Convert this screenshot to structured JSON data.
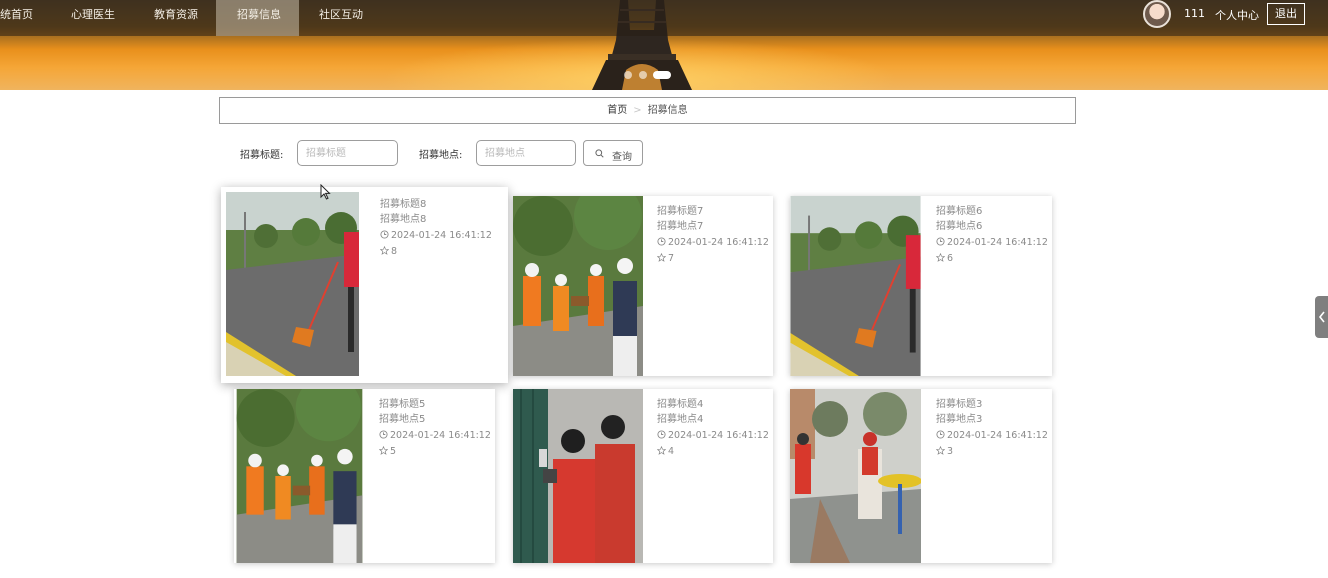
{
  "nav": {
    "items": [
      {
        "label": "统首页"
      },
      {
        "label": "心理医生"
      },
      {
        "label": "教育资源"
      },
      {
        "label": "招募信息"
      },
      {
        "label": "社区互动"
      }
    ],
    "user_id": "111",
    "personal_center": "个人中心",
    "logout": "退出"
  },
  "breadcrumb": {
    "home": "首页",
    "separator": ">",
    "current": "招募信息"
  },
  "search": {
    "title_label": "招募标题:",
    "title_placeholder": "招募标题",
    "location_label": "招募地点:",
    "location_placeholder": "招募地点",
    "button_label": "查询"
  },
  "cards": [
    {
      "title": "招募标题8",
      "location": "招募地点8",
      "time": "2024-01-24 16:41:12",
      "favorites": "8",
      "scene": "sweeping"
    },
    {
      "title": "招募标题7",
      "location": "招募地点7",
      "time": "2024-01-24 16:41:12",
      "favorites": "7",
      "scene": "volunteers"
    },
    {
      "title": "招募标题6",
      "location": "招募地点6",
      "time": "2024-01-24 16:41:12",
      "favorites": "6",
      "scene": "sweeping"
    },
    {
      "title": "招募标题5",
      "location": "招募地点5",
      "time": "2024-01-24 16:41:12",
      "favorites": "5",
      "scene": "volunteers"
    },
    {
      "title": "招募标题4",
      "location": "招募地点4",
      "time": "2024-01-24 16:41:12",
      "favorites": "4",
      "scene": "doorway"
    },
    {
      "title": "招募标题3",
      "location": "招募地点3",
      "time": "2024-01-24 16:41:12",
      "favorites": "3",
      "scene": "exercise"
    }
  ],
  "colors": {
    "card_text": "#8a8a8a",
    "nav_active": "#c8bea9",
    "banner_orange": "#f09a26"
  },
  "icons": {
    "clock": "clock-icon",
    "star": "star-icon",
    "search": "search-icon"
  }
}
